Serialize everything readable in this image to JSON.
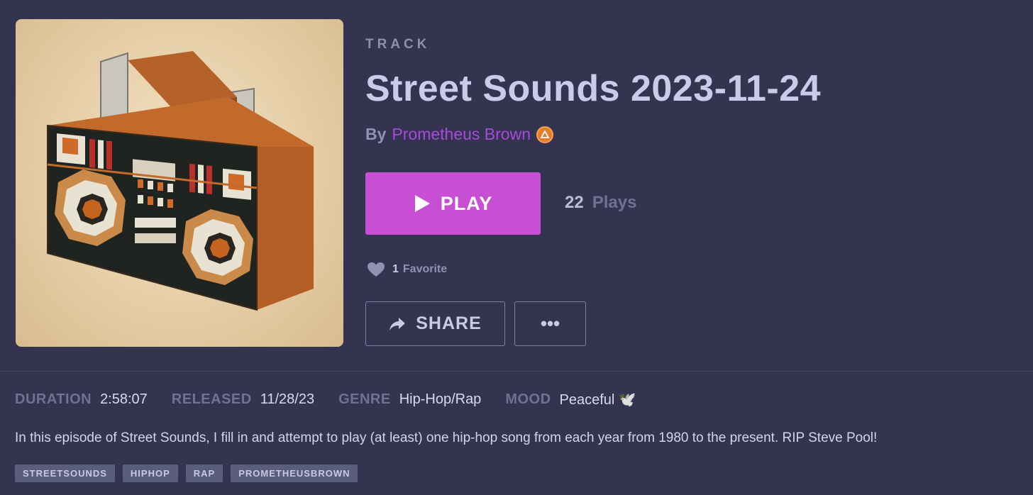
{
  "track": {
    "kicker": "TRACK",
    "title": "Street Sounds 2023-11-24",
    "by_label": "By",
    "artist": "Prometheus Brown",
    "artist_badge_icon": "pro-badge-icon"
  },
  "actions": {
    "play_label": "PLAY",
    "plays_count": "22",
    "plays_label": "Plays",
    "favorites_count": "1",
    "favorites_label": "Favorite",
    "share_label": "SHARE",
    "more_label": "•••"
  },
  "meta": {
    "duration_label": "DURATION",
    "duration": "2:58:07",
    "released_label": "RELEASED",
    "released": "11/28/23",
    "genre_label": "GENRE",
    "genre": "Hip-Hop/Rap",
    "mood_label": "MOOD",
    "mood": "Peaceful 🕊️"
  },
  "description": "In this episode of Street Sounds, I fill in and attempt to play (at least) one hip-hop song from each year from 1980 to the present. RIP Steve Pool!",
  "tags": [
    "STREETSOUNDS",
    "HIPHOP",
    "RAP",
    "PROMETHEUSBROWN"
  ],
  "colors": {
    "background": "#343451",
    "play_button": "#c64fd3",
    "artist_link": "#a64bd8",
    "badge": "#e37f2b"
  }
}
